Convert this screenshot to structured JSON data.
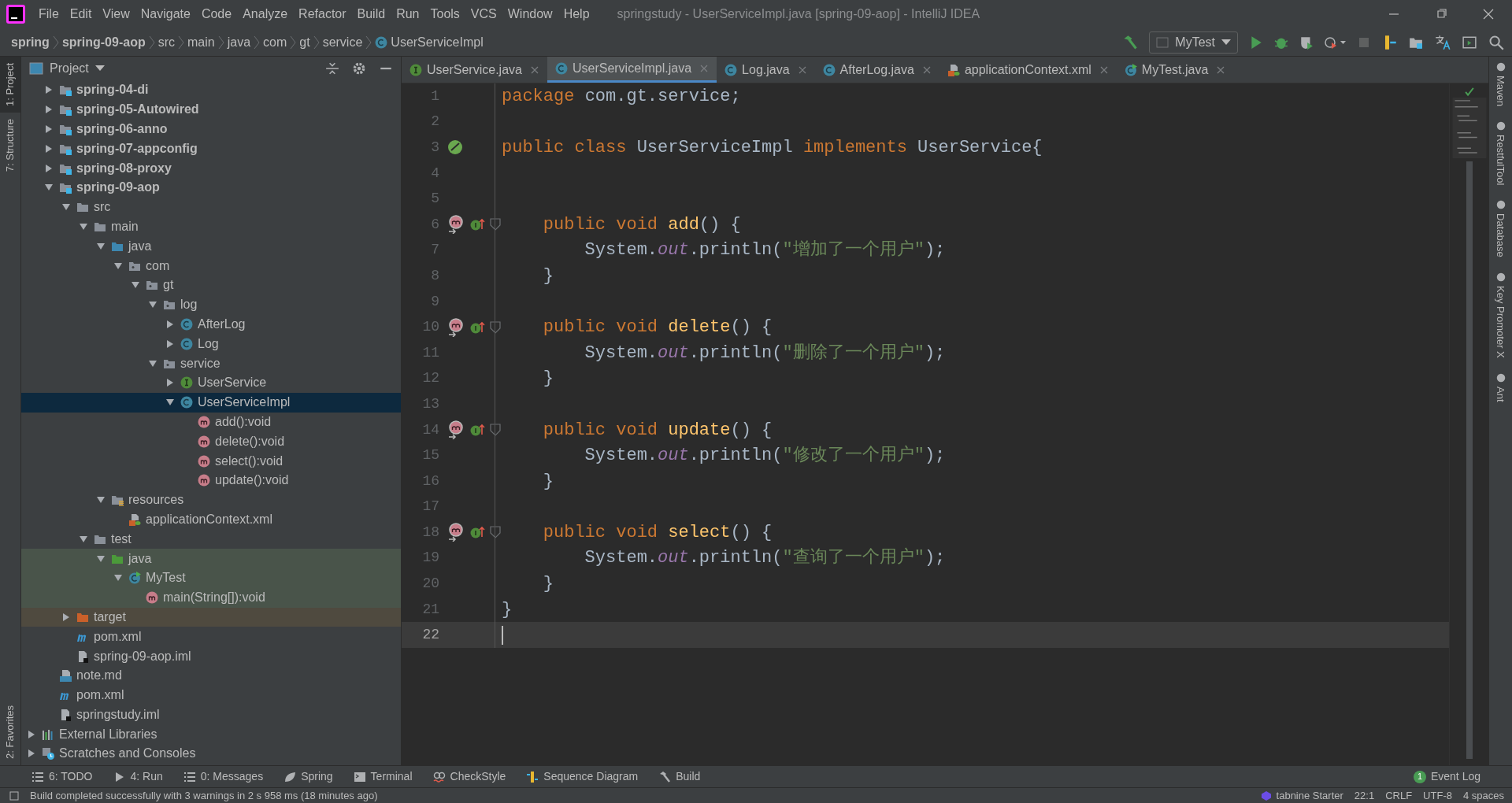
{
  "window": {
    "title": "springstudy - UserServiceImpl.java [spring-09-aop] - IntelliJ IDEA"
  },
  "menu": [
    "File",
    "Edit",
    "View",
    "Navigate",
    "Code",
    "Analyze",
    "Refactor",
    "Build",
    "Run",
    "Tools",
    "VCS",
    "Window",
    "Help"
  ],
  "breadcrumbs": [
    {
      "label": "spring",
      "kind": "bold"
    },
    {
      "label": "spring-09-aop",
      "kind": "bold"
    },
    {
      "label": "src",
      "kind": "plain"
    },
    {
      "label": "main",
      "kind": "plain"
    },
    {
      "label": "java",
      "kind": "plain"
    },
    {
      "label": "com",
      "kind": "plain"
    },
    {
      "label": "gt",
      "kind": "plain"
    },
    {
      "label": "service",
      "kind": "plain"
    },
    {
      "label": "UserServiceImpl",
      "kind": "class"
    }
  ],
  "run_config": "MyTest",
  "left_strip": [
    {
      "label": "1: Project",
      "selected": true
    },
    {
      "label": "7: Structure",
      "selected": false
    }
  ],
  "left_strip_bottom": [
    {
      "label": "2: Favorites",
      "selected": false
    }
  ],
  "project_panel": {
    "title": "Project"
  },
  "tree": {
    "project_items": [
      {
        "label": "spring-04-di",
        "kind": "module",
        "expanded": false,
        "selected": false
      },
      {
        "label": "spring-05-Autowired",
        "kind": "module",
        "expanded": false,
        "selected": false
      },
      {
        "label": "spring-06-anno",
        "kind": "module",
        "expanded": false,
        "selected": false
      },
      {
        "label": "spring-07-appconfig",
        "kind": "module",
        "expanded": false,
        "selected": false
      },
      {
        "label": "spring-08-proxy",
        "kind": "module",
        "expanded": false,
        "selected": false
      },
      {
        "label": "spring-09-aop",
        "kind": "module",
        "expanded": true,
        "selected": false,
        "children": [
          {
            "label": "src",
            "kind": "folder",
            "expanded": true,
            "selected": false,
            "children": [
              {
                "label": "main",
                "kind": "folder",
                "expanded": true,
                "selected": false,
                "children": [
                  {
                    "label": "java",
                    "kind": "source",
                    "expanded": true,
                    "selected": false,
                    "children": [
                      {
                        "label": "com",
                        "kind": "package",
                        "expanded": true,
                        "selected": false,
                        "children": [
                          {
                            "label": "gt",
                            "kind": "package",
                            "expanded": true,
                            "selected": false,
                            "children": [
                              {
                                "label": "log",
                                "kind": "package",
                                "expanded": true,
                                "selected": false,
                                "children": [
                                  {
                                    "label": "AfterLog",
                                    "kind": "class",
                                    "expanded": false,
                                    "selected": false
                                  },
                                  {
                                    "label": "Log",
                                    "kind": "class",
                                    "expanded": false,
                                    "selected": false
                                  }
                                ]
                              },
                              {
                                "label": "service",
                                "kind": "package",
                                "expanded": true,
                                "selected": false,
                                "children": [
                                  {
                                    "label": "UserService",
                                    "kind": "interface",
                                    "expanded": false,
                                    "selected": false
                                  },
                                  {
                                    "label": "UserServiceImpl",
                                    "kind": "class",
                                    "expanded": true,
                                    "selected": true,
                                    "children": [
                                      {
                                        "label": "add():void",
                                        "kind": "method",
                                        "selected": false
                                      },
                                      {
                                        "label": "delete():void",
                                        "kind": "method",
                                        "selected": false
                                      },
                                      {
                                        "label": "select():void",
                                        "kind": "method",
                                        "selected": false
                                      },
                                      {
                                        "label": "update():void",
                                        "kind": "method",
                                        "selected": false
                                      }
                                    ]
                                  }
                                ]
                              }
                            ]
                          }
                        ]
                      }
                    ]
                  },
                  {
                    "label": "resources",
                    "kind": "resources",
                    "expanded": true,
                    "selected": false,
                    "children": [
                      {
                        "label": "applicationContext.xml",
                        "kind": "xml",
                        "selected": false
                      }
                    ]
                  }
                ]
              },
              {
                "label": "test",
                "kind": "folder",
                "expanded": true,
                "selected": false,
                "children": [
                  {
                    "label": "java",
                    "kind": "test-source",
                    "expanded": true,
                    "selected": false,
                    "children": [
                      {
                        "label": "MyTest",
                        "kind": "test-class",
                        "expanded": true,
                        "selected": false,
                        "children": [
                          {
                            "label": "main(String[]):void",
                            "kind": "test-method",
                            "selected": false
                          }
                        ]
                      }
                    ]
                  }
                ]
              }
            ]
          },
          {
            "label": "target",
            "kind": "excluded",
            "expanded": false,
            "selected": false
          },
          {
            "label": "pom.xml",
            "kind": "maven",
            "selected": false
          },
          {
            "label": "spring-09-aop.iml",
            "kind": "iml",
            "selected": false
          }
        ]
      },
      {
        "label": "note.md",
        "kind": "md",
        "selected": false
      },
      {
        "label": "pom.xml",
        "kind": "maven",
        "selected": false
      },
      {
        "label": "springstudy.iml",
        "kind": "iml",
        "selected": false
      }
    ],
    "top_items": [
      {
        "label": "External Libraries",
        "kind": "libraries",
        "expanded": false,
        "selected": false
      },
      {
        "label": "Scratches and Consoles",
        "kind": "scratches",
        "expanded": false,
        "selected": false
      }
    ]
  },
  "tabs": [
    {
      "label": "UserService.java",
      "kind": "interface",
      "selected": false
    },
    {
      "label": "UserServiceImpl.java",
      "kind": "class",
      "selected": true
    },
    {
      "label": "Log.java",
      "kind": "class",
      "selected": false
    },
    {
      "label": "AfterLog.java",
      "kind": "class",
      "selected": false
    },
    {
      "label": "applicationContext.xml",
      "kind": "xml",
      "selected": false
    },
    {
      "label": "MyTest.java",
      "kind": "test-class",
      "selected": false
    }
  ],
  "code": [
    {
      "number": "1",
      "current": false,
      "kind": "plain",
      "tokens": [
        {
          "t": "package ",
          "kind": "keyword"
        },
        {
          "t": "com.gt.service;",
          "kind": "plain"
        }
      ]
    },
    {
      "number": "2",
      "current": false,
      "kind": "plain"
    },
    {
      "number": "3",
      "current": false,
      "kind": "bean",
      "tokens": [
        {
          "t": "public class ",
          "kind": "keyword"
        },
        {
          "t": "UserServiceImpl ",
          "kind": "plain"
        },
        {
          "t": "implements ",
          "kind": "keyword"
        },
        {
          "t": "UserService",
          "kind": "plain"
        },
        {
          "t": "{",
          "kind": "brace"
        }
      ]
    },
    {
      "number": "4",
      "current": false,
      "kind": "plain"
    },
    {
      "number": "5",
      "current": false,
      "kind": "plain"
    },
    {
      "number": "6",
      "current": false,
      "kind": "implements",
      "tokens": [
        {
          "t": "    public void ",
          "kind": "keyword"
        },
        {
          "t": "add",
          "kind": "method"
        },
        {
          "t": "() ",
          "kind": "plain"
        },
        {
          "t": "{",
          "kind": "brace"
        }
      ]
    },
    {
      "number": "7",
      "current": false,
      "kind": "plain",
      "tokens": [
        {
          "t": "        System.",
          "kind": "plain"
        },
        {
          "t": "out",
          "kind": "field"
        },
        {
          "t": ".println(",
          "kind": "plain"
        },
        {
          "t": "\"增加了一个用户\"",
          "kind": "string"
        },
        {
          "t": ");",
          "kind": "plain"
        }
      ]
    },
    {
      "number": "8",
      "current": false,
      "kind": "fold",
      "tokens": [
        {
          "t": "    }",
          "kind": "brace"
        }
      ]
    },
    {
      "number": "9",
      "current": false,
      "kind": "plain"
    },
    {
      "number": "10",
      "current": false,
      "kind": "implements",
      "tokens": [
        {
          "t": "    public void ",
          "kind": "keyword"
        },
        {
          "t": "delete",
          "kind": "method"
        },
        {
          "t": "() ",
          "kind": "plain"
        },
        {
          "t": "{",
          "kind": "brace"
        }
      ]
    },
    {
      "number": "11",
      "current": false,
      "kind": "plain",
      "tokens": [
        {
          "t": "        System.",
          "kind": "plain"
        },
        {
          "t": "out",
          "kind": "field"
        },
        {
          "t": ".println(",
          "kind": "plain"
        },
        {
          "t": "\"删除了一个用户\"",
          "kind": "string"
        },
        {
          "t": ");",
          "kind": "plain"
        }
      ]
    },
    {
      "number": "12",
      "current": false,
      "kind": "fold",
      "tokens": [
        {
          "t": "    }",
          "kind": "brace"
        }
      ]
    },
    {
      "number": "13",
      "current": false,
      "kind": "plain"
    },
    {
      "number": "14",
      "current": false,
      "kind": "implements",
      "tokens": [
        {
          "t": "    public void ",
          "kind": "keyword"
        },
        {
          "t": "update",
          "kind": "method"
        },
        {
          "t": "() ",
          "kind": "plain"
        },
        {
          "t": "{",
          "kind": "brace"
        }
      ]
    },
    {
      "number": "15",
      "current": false,
      "kind": "plain",
      "tokens": [
        {
          "t": "        System.",
          "kind": "plain"
        },
        {
          "t": "out",
          "kind": "field"
        },
        {
          "t": ".println(",
          "kind": "plain"
        },
        {
          "t": "\"修改了一个用户\"",
          "kind": "string"
        },
        {
          "t": ");",
          "kind": "plain"
        }
      ]
    },
    {
      "number": "16",
      "current": false,
      "kind": "fold",
      "tokens": [
        {
          "t": "    }",
          "kind": "brace"
        }
      ]
    },
    {
      "number": "17",
      "current": false,
      "kind": "plain"
    },
    {
      "number": "18",
      "current": false,
      "kind": "implements",
      "tokens": [
        {
          "t": "    public void ",
          "kind": "keyword"
        },
        {
          "t": "select",
          "kind": "method"
        },
        {
          "t": "() ",
          "kind": "plain"
        },
        {
          "t": "{",
          "kind": "brace"
        }
      ]
    },
    {
      "number": "19",
      "current": false,
      "kind": "plain",
      "tokens": [
        {
          "t": "        System.",
          "kind": "plain"
        },
        {
          "t": "out",
          "kind": "field"
        },
        {
          "t": ".println(",
          "kind": "plain"
        },
        {
          "t": "\"查询了一个用户\"",
          "kind": "string"
        },
        {
          "t": ");",
          "kind": "plain"
        }
      ]
    },
    {
      "number": "20",
      "current": false,
      "kind": "fold",
      "tokens": [
        {
          "t": "    }",
          "kind": "brace"
        }
      ]
    },
    {
      "number": "21",
      "current": false,
      "kind": "plain",
      "tokens": [
        {
          "t": "}",
          "kind": "brace"
        }
      ]
    },
    {
      "number": "22",
      "current": true,
      "kind": "plain"
    }
  ],
  "right_strip": [
    "Maven",
    "RestfulTool",
    "Database",
    "Key Promoter X",
    "Ant"
  ],
  "tool_windows": [
    {
      "label": "6: TODO",
      "kind": "list"
    },
    {
      "label": "4: Run",
      "kind": "run"
    },
    {
      "label": "0: Messages",
      "kind": "list"
    },
    {
      "label": "Spring",
      "kind": "spring"
    },
    {
      "label": "Terminal",
      "kind": "terminal"
    },
    {
      "label": "CheckStyle",
      "kind": "checkstyle"
    },
    {
      "label": "Sequence Diagram",
      "kind": "sequence"
    },
    {
      "label": "Build",
      "kind": "build"
    }
  ],
  "event_log": {
    "label": "Event Log",
    "count": "1"
  },
  "status_bar": {
    "message": "Build completed successfully with 3 warnings in 2 s 958 ms (18 minutes ago)",
    "plugin": "tabnine Starter",
    "items": [
      "22:1",
      "CRLF",
      "UTF-8",
      "4 spaces"
    ]
  }
}
